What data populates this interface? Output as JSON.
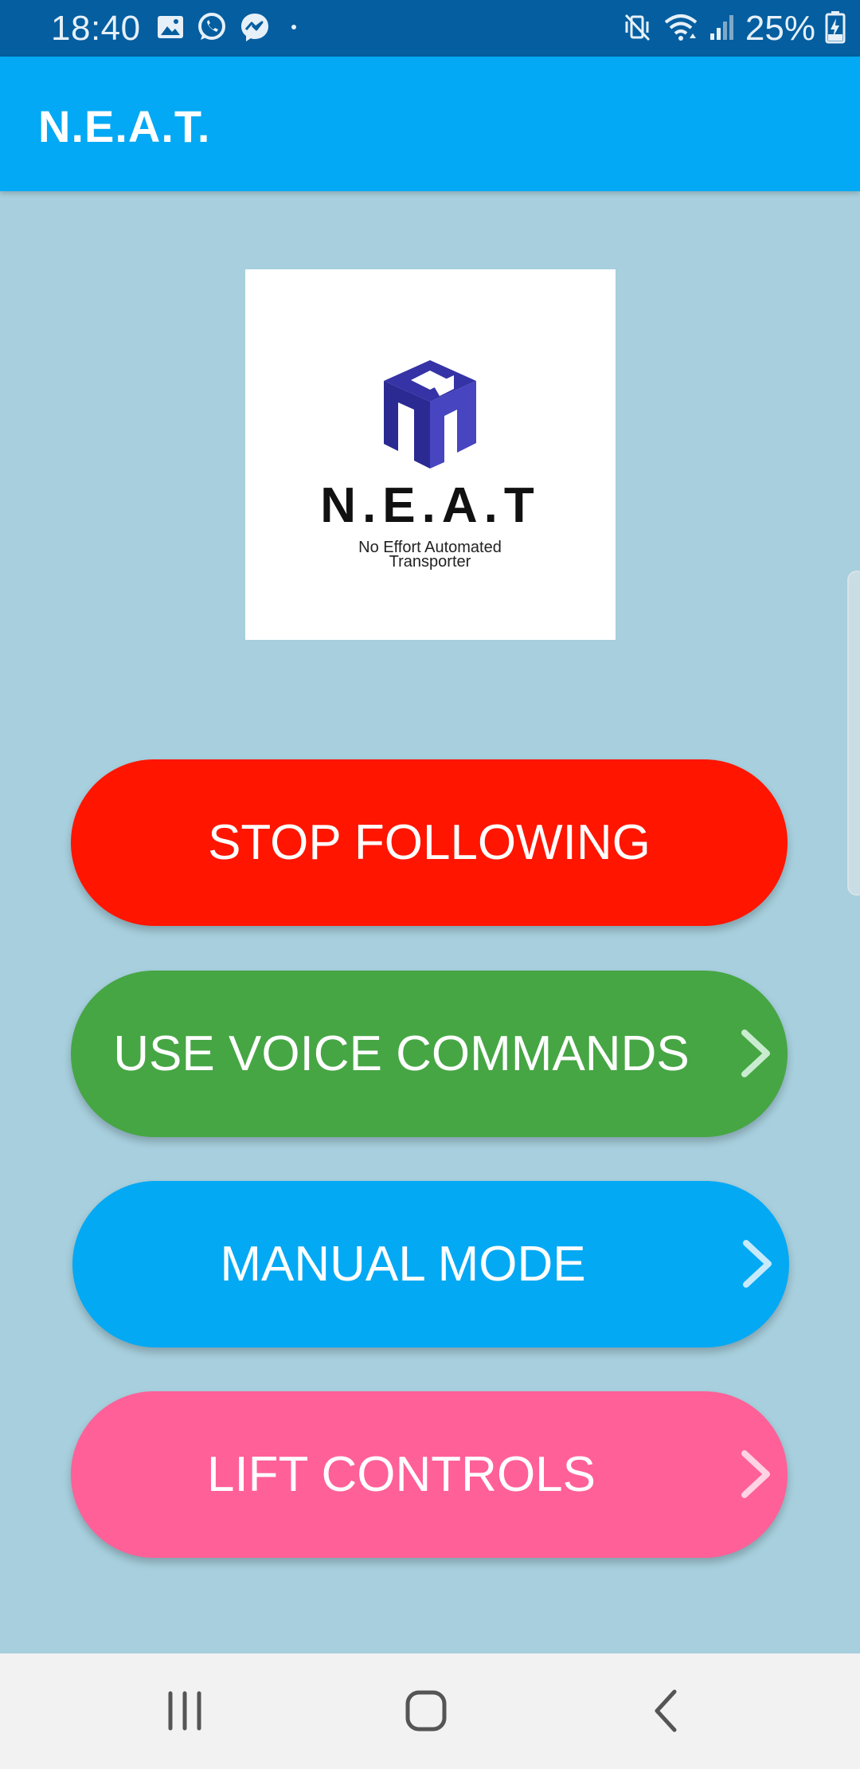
{
  "status_bar": {
    "time": "18:40",
    "battery": "25%",
    "left_icons": [
      "gallery-icon",
      "whatsapp-icon",
      "messenger-icon",
      "dot-icon"
    ],
    "right_icons": [
      "mute-vibrate-icon",
      "wifi-icon",
      "signal-icon",
      "battery-charging-icon"
    ]
  },
  "app_bar": {
    "title": "N.E.A.T."
  },
  "logo": {
    "brand": "N.E.A.T",
    "tagline_line1": "No Effort Automated",
    "tagline_line2": "Transporter",
    "color": "#3533a6"
  },
  "buttons": {
    "stop_following": "STOP FOLLOWING",
    "voice_commands": "USE VOICE COMMANDS",
    "manual_mode": "MANUAL MODE",
    "lift_controls": "LIFT CONTROLS"
  },
  "colors": {
    "status_bar": "#045e9f",
    "app_bar": "#03a9f4",
    "background": "#a7cfdd",
    "stop": "#ff1500",
    "voice": "#46a644",
    "manual": "#04a9f4",
    "lift": "#ff6098",
    "nav_bar": "#f2f2f2"
  },
  "nav_bar": {
    "icons": [
      "recent-apps-icon",
      "home-icon",
      "back-icon"
    ]
  }
}
